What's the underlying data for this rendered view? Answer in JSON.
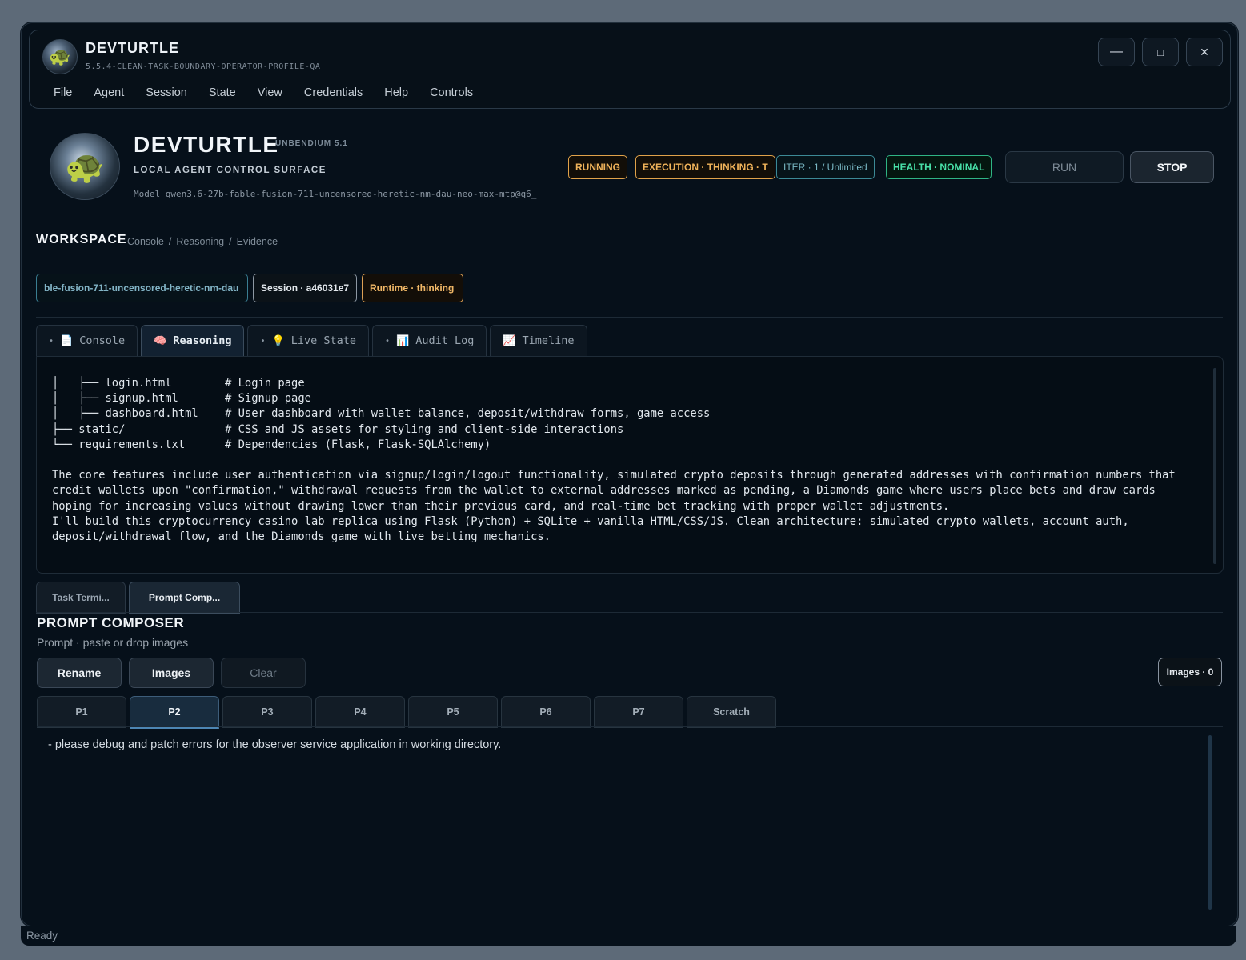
{
  "window": {
    "title": "DEVTURTLE",
    "subtitle": "5.5.4-CLEAN-TASK-BOUNDARY-OPERATOR-PROFILE-QA",
    "controls": {
      "minimize": "—",
      "maximize": "□",
      "close": "✕"
    }
  },
  "menu": [
    "File",
    "Agent",
    "Session",
    "State",
    "View",
    "Credentials",
    "Help",
    "Controls"
  ],
  "hero": {
    "title": "DEVTURTLE",
    "version": "UNBENDIUM 5.1",
    "subtitle": "LOCAL AGENT CONTROL SURFACE",
    "model": "Model qwen3.6-27b-fable-fusion-711-uncensored-heretic-nm-dau-neo-max-mtp@q6_"
  },
  "status_pills": {
    "running": "RUNNING",
    "execution": "EXECUTION · THINKING · T",
    "iter": "ITER · 1 / Unlimited",
    "health": "HEALTH · NOMINAL"
  },
  "buttons": {
    "run": "RUN",
    "stop": "STOP"
  },
  "workspace": {
    "title": "WORKSPACE",
    "crumbs": [
      "Console",
      "Reasoning",
      "Evidence"
    ],
    "crumb_sep": "/",
    "model_chip": "ble-fusion-711-uncensored-heretic-nm-dau",
    "session_chip": "Session · a46031e7",
    "runtime_chip": "Runtime · thinking"
  },
  "tabs": [
    {
      "label": "Console",
      "icon": "📄",
      "dot": "•"
    },
    {
      "label": "Reasoning",
      "icon": "🧠",
      "dot": ""
    },
    {
      "label": "Live State",
      "icon": "💡",
      "dot": "•"
    },
    {
      "label": "Audit Log",
      "icon": "📊",
      "dot": "•"
    },
    {
      "label": "Timeline",
      "icon": "📈",
      "dot": ""
    }
  ],
  "console_text": "│   ├── login.html        # Login page\n│   ├── signup.html       # Signup page\n│   ├── dashboard.html    # User dashboard with wallet balance, deposit/withdraw forms, game access\n├── static/               # CSS and JS assets for styling and client-side interactions\n└── requirements.txt      # Dependencies (Flask, Flask-SQLAlchemy)\n\nThe core features include user authentication via signup/login/logout functionality, simulated crypto deposits through generated addresses with confirmation numbers that credit wallets upon \"confirmation,\" withdrawal requests from the wallet to external addresses marked as pending, a Diamonds game where users place bets and draw cards hoping for increasing values without drawing lower than their previous card, and real-time bet tracking with proper wallet adjustments.\nI'll build this cryptocurrency casino lab replica using Flask (Python) + SQLite + vanilla HTML/CSS/JS. Clean architecture: simulated crypto wallets, account auth, deposit/withdrawal flow, and the Diamonds game with live betting mechanics.",
  "subtabs": [
    "Task Termi...",
    "Prompt Comp..."
  ],
  "composer": {
    "title": "PROMPT COMPOSER",
    "subtitle": "Prompt · paste or drop images",
    "rename": "Rename",
    "images": "Images",
    "clear": "Clear",
    "images_count": "Images · 0",
    "prompt_tabs": [
      "P1",
      "P2",
      "P3",
      "P4",
      "P5",
      "P6",
      "P7",
      "Scratch"
    ],
    "active_tab": "P2",
    "text": "- please debug and patch errors for the observer service application in working directory."
  },
  "statusbar": {
    "text": "Ready"
  }
}
